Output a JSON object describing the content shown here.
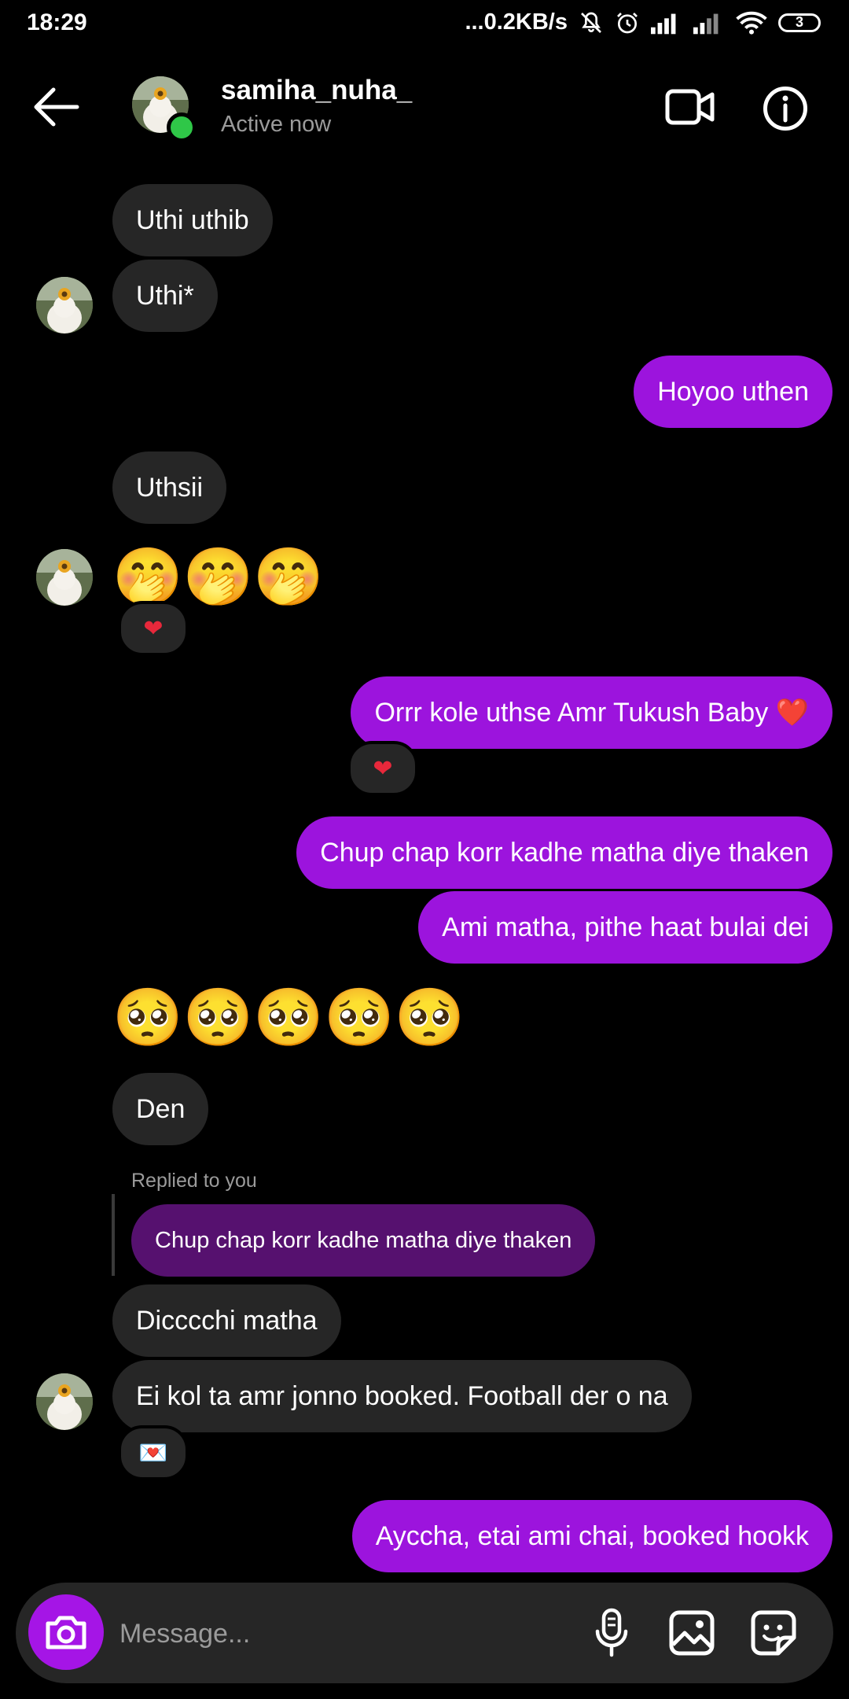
{
  "status_bar": {
    "time": "18:29",
    "network_speed": "...0.2KB/s",
    "battery_level": "3"
  },
  "header": {
    "username": "samiha_nuha_",
    "presence": "Active now"
  },
  "messages": {
    "m1": "Uthi uthib",
    "m2": "Uthi*",
    "m3": "Hoyoo uthen",
    "m4": "Uthsii",
    "m5_emojis": "🤭🤭🤭",
    "m5_reaction": "❤",
    "m6": "Orrr kole uthse Amr Tukush Baby ❤️",
    "m6_reaction": "❤",
    "m7": "Chup chap korr kadhe matha diye thaken",
    "m8": "Ami matha, pithe haat bulai dei",
    "m9_emojis": "🥺🥺🥺🥺🥺",
    "m10": "Den",
    "reply_label": "Replied to you",
    "reply_quote": "Chup chap korr kadhe matha diye thaken",
    "m11": "Dicccchi matha",
    "m12": "Ei kol ta amr jonno booked. Football der o na",
    "m12_reaction": "💌",
    "m13": "Ayccha, etai ami chai, booked hookk"
  },
  "composer": {
    "placeholder": "Message..."
  },
  "colors": {
    "background": "#000000",
    "incoming_bubble": "#262626",
    "outgoing_bubble": "#9c14dd",
    "reply_quote": "#56116f",
    "online": "#2fc748",
    "camera_button": "#a515e6"
  },
  "icons": [
    "back-arrow-icon",
    "video-call-icon",
    "info-icon",
    "camera-icon",
    "microphone-icon",
    "gallery-icon",
    "sticker-icon",
    "mute-icon",
    "alarm-icon",
    "signal-icon",
    "wifi-icon",
    "battery-icon"
  ]
}
